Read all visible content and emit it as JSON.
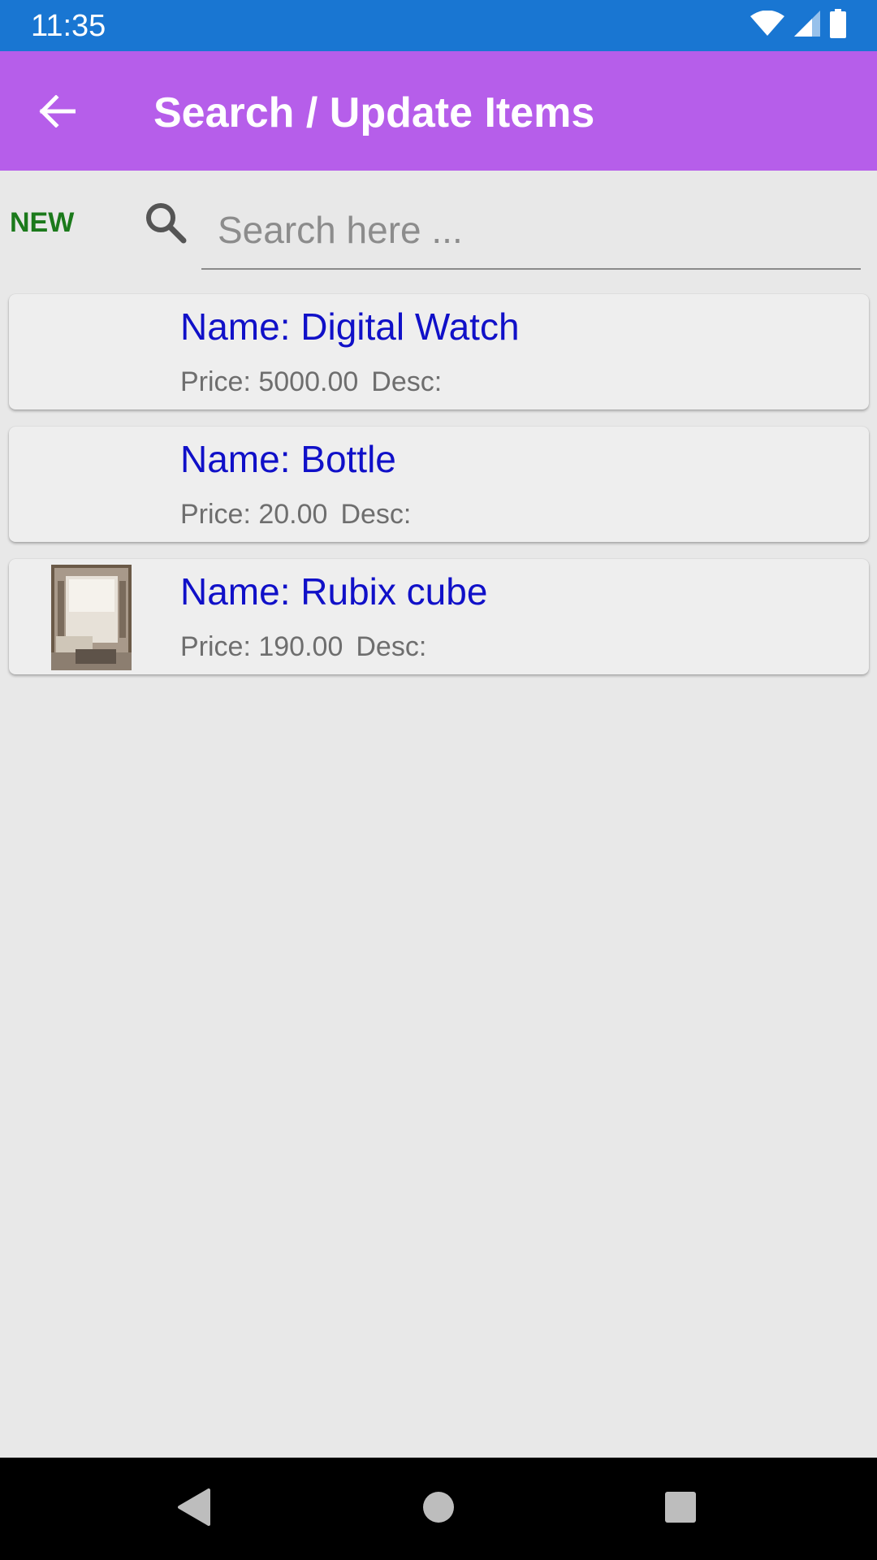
{
  "status_bar": {
    "time": "11:35",
    "icons": [
      "wifi-icon",
      "cellular-signal-icon",
      "battery-icon"
    ]
  },
  "app_bar": {
    "back_icon": "arrow-back-icon",
    "title": "Search / Update Items",
    "background_color": "#b65eea"
  },
  "search": {
    "new_label": "NEW",
    "new_color": "#1b7a1b",
    "icon": "search-icon",
    "placeholder": "Search here ...",
    "value": ""
  },
  "items": [
    {
      "name": "Name: Digital Watch",
      "price": "Price: 5000.00",
      "desc": "Desc:",
      "has_image": false
    },
    {
      "name": "Name: Bottle",
      "price": "Price: 20.00",
      "desc": "Desc:",
      "has_image": false
    },
    {
      "name": "Name: Rubix cube",
      "price": "Price: 190.00",
      "desc": "Desc:",
      "has_image": true
    }
  ],
  "nav_bar": {
    "icons": [
      "nav-back-icon",
      "nav-home-icon",
      "nav-recents-icon"
    ]
  },
  "colors": {
    "status_bar": "#1976d2",
    "item_name": "#1010c8",
    "item_meta": "#6e6e6e",
    "background": "#e8e8e8"
  }
}
